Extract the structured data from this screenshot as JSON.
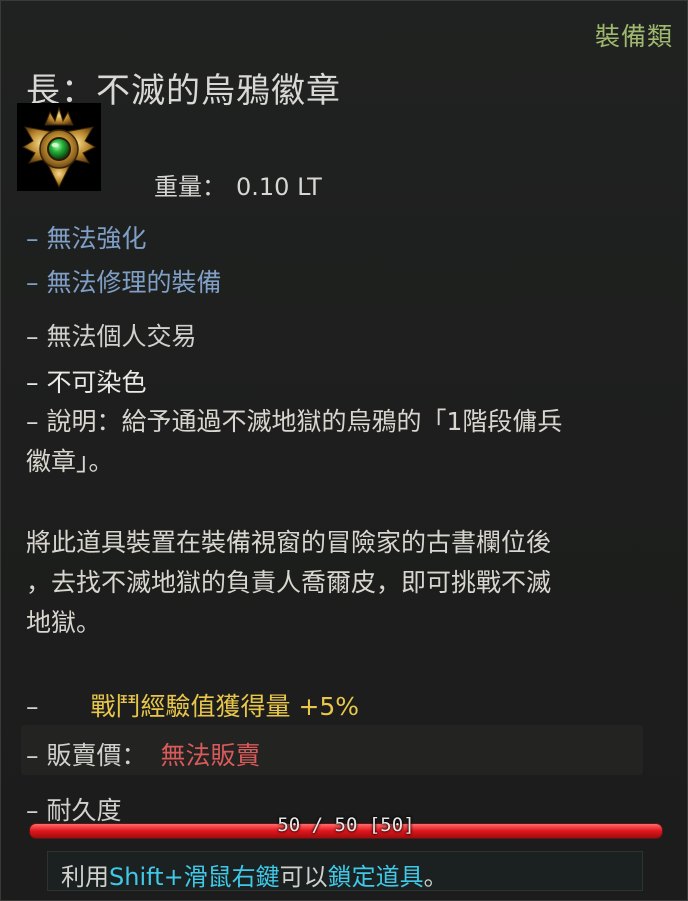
{
  "category": "裝備類",
  "item_name": "長：不滅的烏鴉徽章",
  "weight": {
    "label": "重量：",
    "value": "0.10 LT"
  },
  "tags": {
    "no_enhance": "– 無法強化",
    "no_repair": "– 無法修理的裝備",
    "no_trade": "– 無法個人交易",
    "no_dye": "– 不可染色"
  },
  "description": {
    "line1": "– 說明：給予通過不滅地獄的烏鴉的「1階段傭兵",
    "line2": "徽章」。",
    "para_line1": "將此道具裝置在裝備視窗的冒險家的古書欄位後",
    "para_line2": "，去找不滅地獄的負責人喬爾皮，即可挑戰不滅",
    "para_line3": "地獄。"
  },
  "bonus": {
    "dash": "–",
    "text": "戰鬥經驗值獲得量 +5%"
  },
  "sell": {
    "label": "– 販賣價：",
    "value": "無法販賣"
  },
  "durability": {
    "label": "– 耐久度",
    "text": "50 / 50 [50]",
    "fraction": 1.0
  },
  "hint": {
    "part1": "利用",
    "key1": "Shift",
    "plus": "+",
    "key2": "滑鼠右鍵",
    "part2": "可以",
    "action": "鎖定道具",
    "end": "。"
  },
  "colors": {
    "category": "#9fb86e",
    "blue_tag": "#7f9fc6",
    "bonus": "#e8c64a",
    "no_sell": "#d85a5a",
    "hint_key": "#3fc8e8",
    "bar": "#e0161b"
  },
  "icon": {
    "name": "crow-badge-icon"
  }
}
